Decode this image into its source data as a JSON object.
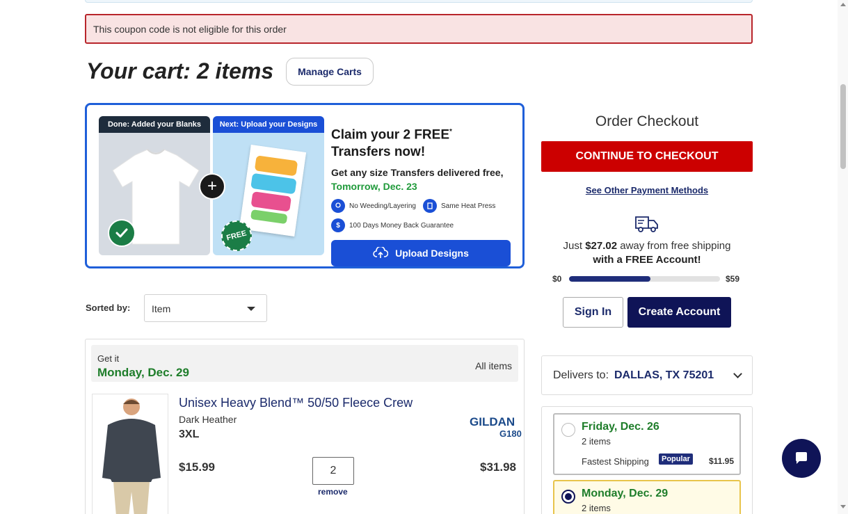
{
  "alert": {
    "coupon_message": "This coupon code is not eligible for this order"
  },
  "cart": {
    "title": "Your cart: 2 items",
    "manage_label": "Manage Carts"
  },
  "promo": {
    "step1_label": "Done: Added your Blanks",
    "step2_label": "Next: Upload your Designs",
    "free_badge": "FREE",
    "title": "Claim your 2 FREE",
    "title_sup": "*",
    "title_line2": "Transfers now!",
    "subtitle": "Get any size Transfers delivered free,",
    "date": "Tomorrow, Dec. 23",
    "features": [
      "No Weeding/Layering",
      "Same Heat Press",
      "100 Days Money Back Guarantee"
    ],
    "upload_label": "Upload Designs"
  },
  "sort": {
    "label": "Sorted by:",
    "value": "Item"
  },
  "group": {
    "get_it_label": "Get it",
    "date": "Monday, Dec. 29",
    "all_items": "All items"
  },
  "product": {
    "name": "Unisex Heavy Blend™ 50/50 Fleece Crew",
    "color": "Dark Heather",
    "size": "3XL",
    "brand": "GILDAN",
    "brand_code": "G180",
    "unit_price": "$15.99",
    "quantity": "2",
    "remove_label": "remove",
    "line_total": "$31.98"
  },
  "checkout": {
    "title": "Order Checkout",
    "continue_label": "CONTINUE TO CHECKOUT",
    "other_payment_label": "See Other Payment Methods",
    "ship_prefix": "Just ",
    "ship_amount": "$27.02",
    "ship_suffix": " away from free shipping",
    "ship_line2": "with a FREE Account!",
    "progress_min": "$0",
    "progress_max": "$59",
    "progress_fraction": 0.54,
    "signin_label": "Sign In",
    "create_label": "Create Account"
  },
  "delivery": {
    "label": "Delivers to:",
    "location": "DALLAS, TX 75201"
  },
  "shipping_options": [
    {
      "date": "Friday, Dec. 26",
      "items": "2 items",
      "method": "Fastest Shipping",
      "badge": "Popular",
      "price": "$11.95",
      "selected": false
    },
    {
      "date": "Monday, Dec. 29",
      "items": "2 items",
      "selected": true
    }
  ],
  "colors": {
    "brand_navy": "#0f1457",
    "checkout_red": "#cc0000",
    "accent_blue": "#1a4fd6",
    "delivery_green": "#1e7d2a"
  },
  "icons": [
    "check-icon",
    "plus-icon",
    "upload-cloud-icon",
    "truck-icon",
    "chevron-down-icon",
    "chat-icon"
  ]
}
